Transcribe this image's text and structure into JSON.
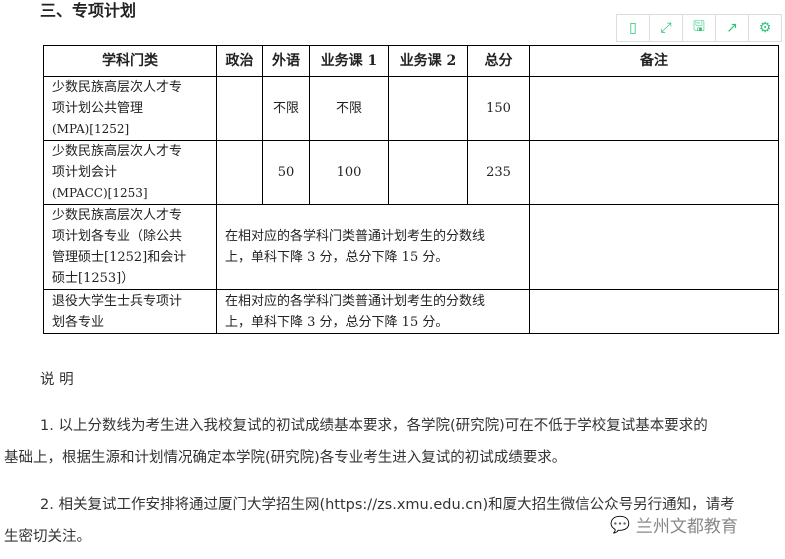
{
  "section_title": "三、专项计划",
  "toolbar": [
    {
      "icon": "tablet-icon",
      "glyph": "▯"
    },
    {
      "icon": "fullscreen-icon",
      "glyph": "⤢"
    },
    {
      "icon": "save-icon",
      "glyph": "🖫"
    },
    {
      "icon": "share-icon",
      "glyph": "↗"
    },
    {
      "icon": "gear-icon",
      "glyph": "⚙"
    }
  ],
  "table": {
    "headers": [
      "学科门类",
      "政治",
      "外语",
      "业务课 1",
      "业务课 2",
      "总分",
      "备注"
    ],
    "rows": [
      {
        "name_lines": [
          "少数民族高层次人才专",
          "项计划公共管理",
          "(MPA)[1252]"
        ],
        "politics": "",
        "foreign": "不限",
        "course1": "不限",
        "course2": "",
        "total": "150",
        "note": ""
      },
      {
        "name_lines": [
          "少数民族高层次人才专",
          "项计划会计",
          "(MPACC)[1253]"
        ],
        "politics": "",
        "foreign": "50",
        "course1": "100",
        "course2": "",
        "total": "235",
        "note": ""
      },
      {
        "name_lines": [
          "少数民族高层次人才专",
          "项计划各专业（除公共",
          "管理硕士[1252]和会计",
          "硕士[1253]）"
        ],
        "merged": [
          "在相对应的各学科门类普通计划考生的分数线",
          "上，单科下降 3 分，总分下降 15 分。"
        ],
        "note": ""
      },
      {
        "name_lines": [
          "退役大学生士兵专项计",
          "划各专业"
        ],
        "merged": [
          "在相对应的各学科门类普通计划考生的分数线",
          "上，单科下降 3 分，总分下降 15 分。"
        ],
        "note": ""
      }
    ]
  },
  "notes": {
    "heading": "说 明",
    "p1_line1": "1. 以上分数线为考生进入我校复试的初试成绩基本要求，各学院(研究院)可在不低于学校复试基本要求的",
    "p1_line2": "基础上，根据生源和计划情况确定本学院(研究院)各专业考生进入复试的初试成绩要求。",
    "p2_line1": "2. 相关复试工作安排将通过厦门大学招生网(https://zs.xmu.edu.cn)和厦大招生微信公众号另行通知，请考",
    "p2_line2": "生密切关注。"
  },
  "watermark": "兰州文都教育"
}
